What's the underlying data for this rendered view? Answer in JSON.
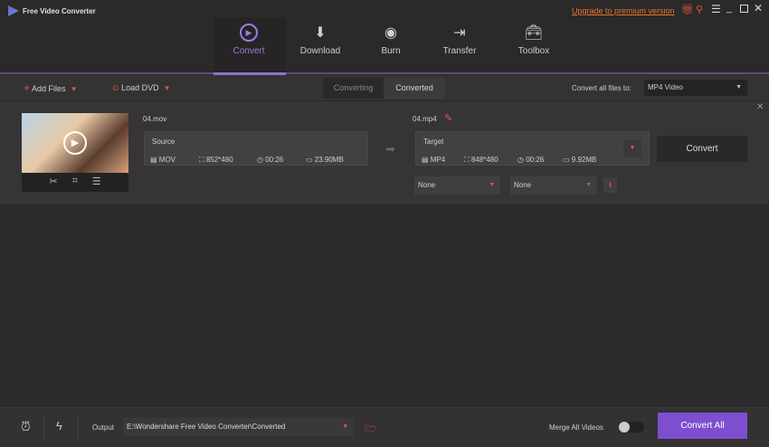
{
  "app": {
    "title": "Free Video Converter",
    "upgrade": "Upgrade to premium version"
  },
  "nav": [
    {
      "label": "Convert"
    },
    {
      "label": "Download"
    },
    {
      "label": "Burn"
    },
    {
      "label": "Transfer"
    },
    {
      "label": "Toolbox"
    }
  ],
  "toolbar": {
    "add_files": "Add Files",
    "load_dvd": "Load DVD",
    "seg_converting": "Converting",
    "seg_converted": "Converted",
    "convert_all_to_label": "Convert all files to:",
    "format": "MP4 Video"
  },
  "file": {
    "source_name": "04.mov",
    "target_name": "04.mp4",
    "source": {
      "label": "Source",
      "format": "MOV",
      "resolution": "852*480",
      "duration": "00:26",
      "size": "23.90MB"
    },
    "target": {
      "label": "Target",
      "format": "MP4",
      "resolution": "848*480",
      "duration": "00:26",
      "size": "9.92MB"
    },
    "convert": "Convert",
    "subtitle": "None",
    "audio": "None"
  },
  "bottom": {
    "output_label": "Output",
    "output_path": "E:\\Wondershare Free Video Converter\\Converted",
    "merge": "Merge All Videos",
    "convert_all": "Convert All"
  },
  "colors": {
    "accent": "#8e5fd6",
    "orange": "#e0583c"
  }
}
